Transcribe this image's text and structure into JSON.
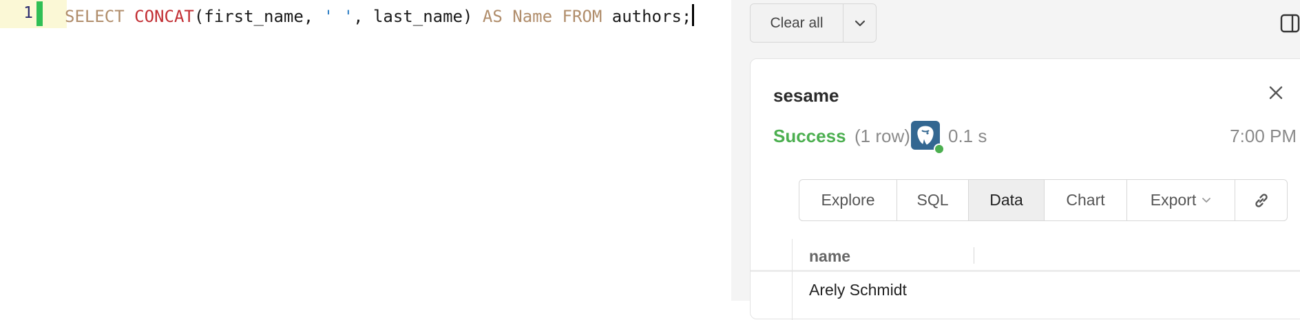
{
  "editor": {
    "line_number": "1",
    "tokens": [
      {
        "text": "SELECT",
        "kind": "kw"
      },
      {
        "text": " ",
        "kind": "plain"
      },
      {
        "text": "CONCAT",
        "kind": "fn"
      },
      {
        "text": "(first_name, ",
        "kind": "plain"
      },
      {
        "text": "' '",
        "kind": "str"
      },
      {
        "text": ", last_name) ",
        "kind": "plain"
      },
      {
        "text": "AS",
        "kind": "kw"
      },
      {
        "text": " ",
        "kind": "plain"
      },
      {
        "text": "Name",
        "kind": "kw"
      },
      {
        "text": " ",
        "kind": "plain"
      },
      {
        "text": "FROM",
        "kind": "kw"
      },
      {
        "text": " authors;",
        "kind": "plain"
      }
    ]
  },
  "toolbar": {
    "clear_all_label": "Clear all",
    "dropdown_icon": "chevron-down-icon",
    "panel_toggle_icon": "sidebar-panel-icon"
  },
  "result": {
    "connection_name": "sesame",
    "status": "Success",
    "row_count": "(1 row)",
    "duration": "0.1 s",
    "timestamp": "7:00 PM",
    "db_icon": "postgresql-elephant-icon",
    "tabs": {
      "explore": "Explore",
      "sql": "SQL",
      "data": "Data",
      "chart": "Chart",
      "export": "Export"
    },
    "table": {
      "columns": [
        "name"
      ],
      "rows": [
        [
          "Arely Schmidt"
        ]
      ]
    }
  },
  "colors": {
    "success": "#4caf50",
    "keyword": "#b08d6b",
    "function": "#c22e33",
    "string": "#2f7fc4",
    "change_marker": "#2fbf55",
    "postgres_blue": "#336791"
  }
}
